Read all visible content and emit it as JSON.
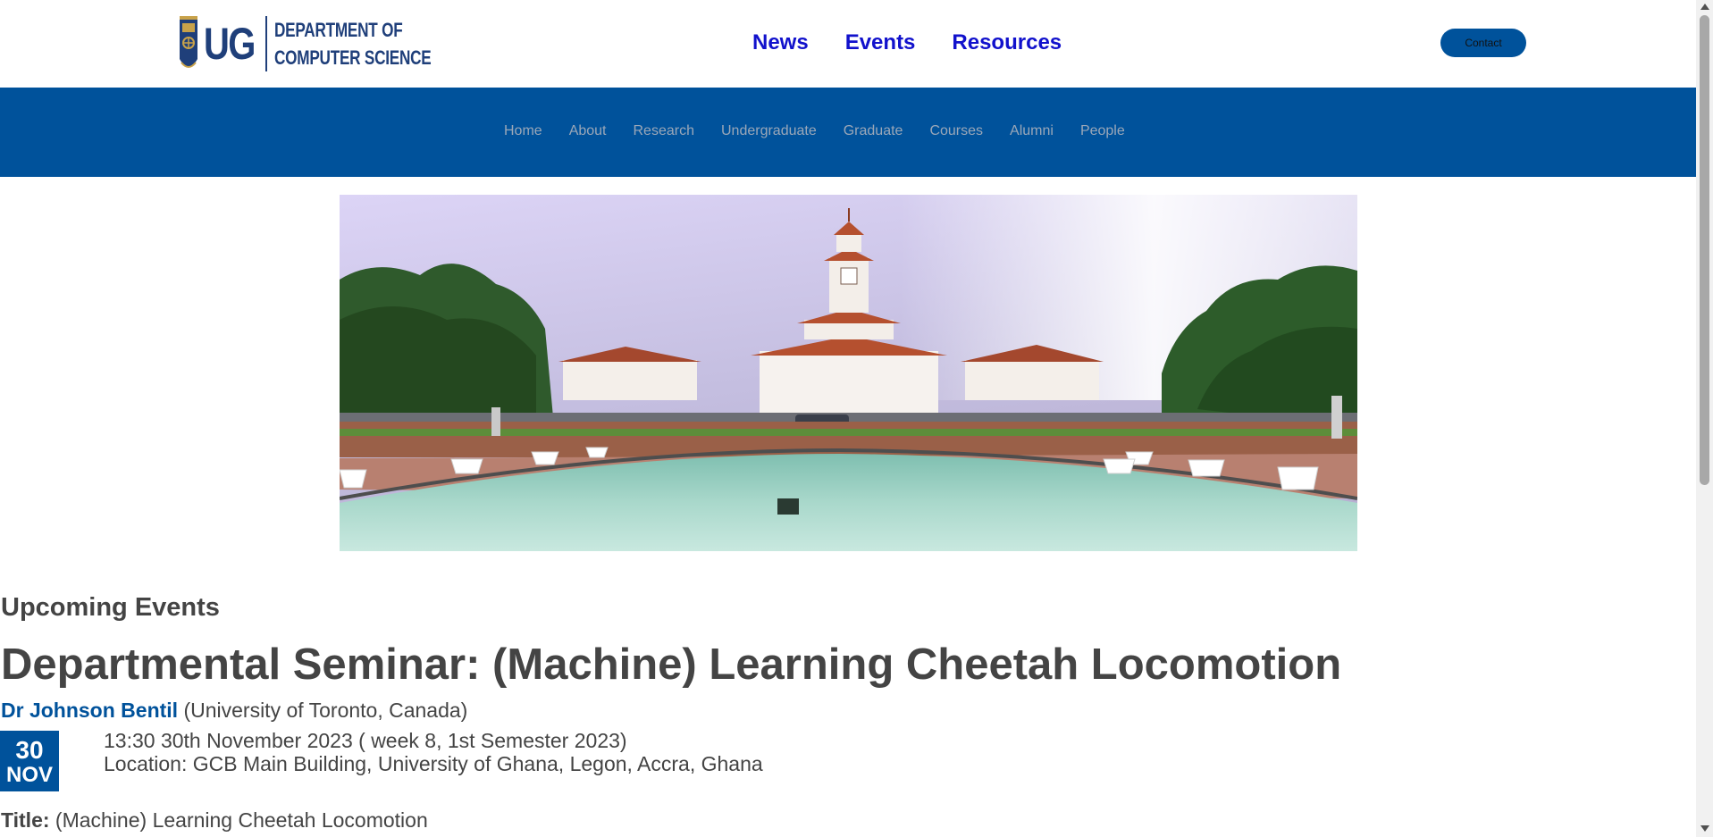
{
  "header": {
    "logo_mark": "UG",
    "logo_line1": "DEPARTMENT OF",
    "logo_line2": "COMPUTER SCIENCE",
    "top_links": [
      "News",
      "Events",
      "Resources"
    ],
    "contact_label": "Contact"
  },
  "nav": {
    "items": [
      "Home",
      "About",
      "Research",
      "Undergraduate",
      "Graduate",
      "Courses",
      "Alumni",
      "People"
    ]
  },
  "content": {
    "section_title": "Upcoming Events",
    "event": {
      "title": "Departmental Seminar: (Machine) Learning Cheetah Locomotion",
      "speaker_name": "Dr Johnson Bentil",
      "speaker_affiliation": "(University of Toronto, Canada)",
      "date_day": "30",
      "date_month": "NOV",
      "time_line": "13:30 30th November 2023 ( week 8, 1st Semester 2023)",
      "location_line": "Location: GCB Main Building, University of Ghana, Legon, Accra, Ghana",
      "talk_title_label": "Title:",
      "talk_title": "(Machine) Learning Cheetah Locomotion"
    }
  },
  "colors": {
    "brand_blue": "#00529b",
    "link_blue": "#1111cc",
    "text": "#444444"
  }
}
